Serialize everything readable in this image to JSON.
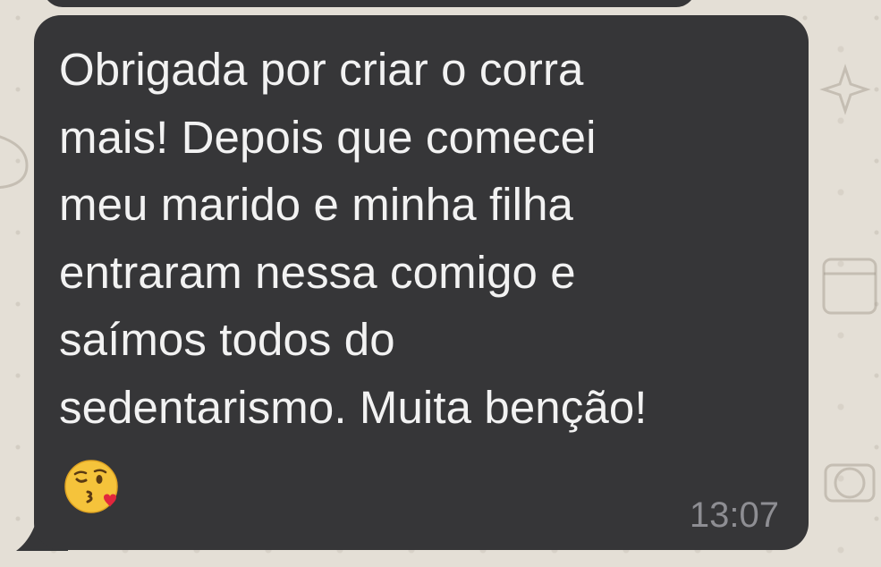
{
  "chat": {
    "message": {
      "lines": [
        "Obrigada por criar o corra",
        "mais! Depois que comecei",
        "meu marido e minha filha",
        "entraram nessa comigo e",
        "saímos todos do",
        "sedentarismo. Muita benção!"
      ],
      "emoji": "face-throwing-a-kiss",
      "time": "13:07"
    }
  },
  "colors": {
    "bubble": "#363638",
    "wallpaper": "#e4dfd6",
    "text": "#f2f2f2",
    "timestamp": "#8e8e93"
  }
}
